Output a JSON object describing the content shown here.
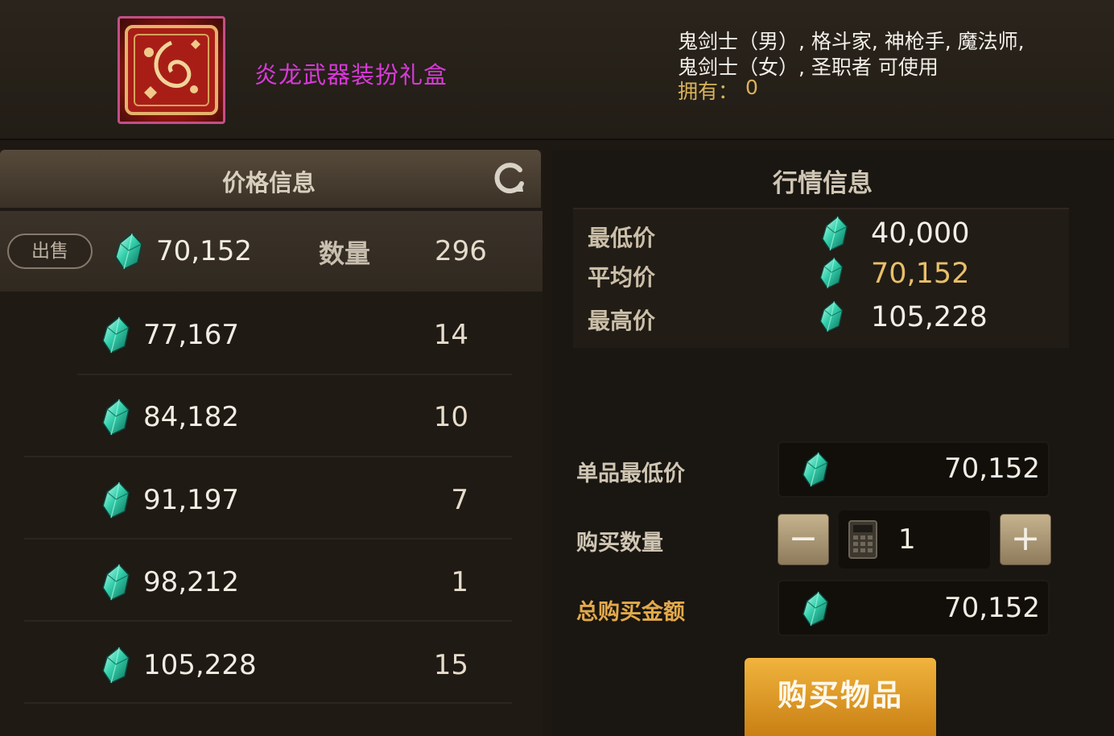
{
  "item": {
    "name": "炎龙武器装扮礼盒",
    "usable_line1": "鬼剑士（男）, 格斗家, 神枪手, 魔法师,",
    "usable_line2": "鬼剑士（女）, 圣职者 可使用",
    "owned_label": "拥有：",
    "owned_value": "0",
    "icon": "gift-box-icon"
  },
  "price_panel": {
    "title": "价格信息",
    "refresh_icon": "refresh-icon",
    "sell_button": "出售",
    "quantity_label": "数量",
    "selected": {
      "price": "70,152",
      "qty": "296"
    },
    "rows": [
      {
        "price": "77,167",
        "qty": "14"
      },
      {
        "price": "84,182",
        "qty": "10"
      },
      {
        "price": "91,197",
        "qty": "7"
      },
      {
        "price": "98,212",
        "qty": "1"
      },
      {
        "price": "105,228",
        "qty": "15"
      }
    ],
    "currency_icon": "gem-icon"
  },
  "market_panel": {
    "title": "行情信息",
    "min_label": "最低价",
    "min_value": "40,000",
    "avg_label": "平均价",
    "avg_value": "70,152",
    "max_label": "最高价",
    "max_value": "105,228"
  },
  "purchase": {
    "unit_label": "单品最低价",
    "unit_value": "70,152",
    "qty_label": "购买数量",
    "qty_value": "1",
    "minus": "−",
    "plus": "+",
    "total_label": "总购买金额",
    "total_value": "70,152",
    "buy_button": "购买物品"
  },
  "colors": {
    "item_name": "#d83ad8",
    "avg_value": "#e8bf6a",
    "total_label": "#e2a94b",
    "buy_button": "#e4a22f",
    "gem": "#2fc9a6"
  }
}
